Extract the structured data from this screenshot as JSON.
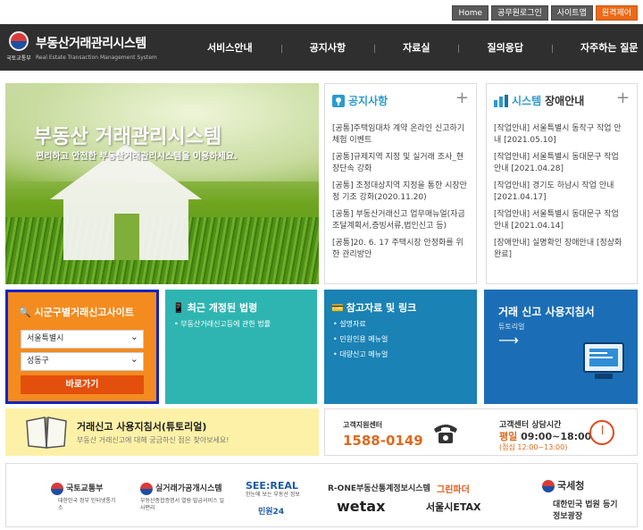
{
  "util": {
    "home": "Home",
    "login": "공무원로그인",
    "sitemap": "사이트맵",
    "remote": "원격제어"
  },
  "header": {
    "ministry": "국토교통부",
    "title": "부동산거래관리시스템",
    "subtitle": "Real Estate Transaction Management System",
    "nav": [
      "서비스안내",
      "공지사항",
      "자료실",
      "질의응답",
      "자주하는 질문"
    ]
  },
  "hero": {
    "title": "부동산 거래관리시스템",
    "subtitle": "편리하고 안전한 부동산거래관리시스템을 이용하세요."
  },
  "notice": {
    "title": "공지사항",
    "more": "+",
    "items": [
      "[공통]주택임대차 계약 온라인 신고하기 체험 이벤트",
      "[공통]규제지역 지정 및 실거래 조사_현장단속 강화",
      "[공통] 조정대상지역 지정을 통한 시장안정 기조 강화(2020.11.20)",
      "[공통] 부동산거래신고 업무매뉴얼(자금조달계획서,증빙서류,법인신고 등)",
      "[공통]20. 6. 17 주택시장 안정화를 위한 관리방안"
    ]
  },
  "system": {
    "title_a": "시스템",
    "title_b": "장애안내",
    "more": "+",
    "items": [
      "[작업안내] 서울특별시 동작구 작업 안내 [2021.05.10]",
      "[작업안내] 서울특별시 동대문구 작업 안내 [2021.04.28]",
      "[작업안내] 경기도 하남시 작업 안내 [2021.04.17]",
      "[작업안내] 서울특별시 동대문구 작업 안내 [2021.04.14]",
      "[장애안내] 실명확인 장애안내 [정상화 완료]"
    ]
  },
  "region": {
    "title": "시군구별거래신고사이트",
    "sido": "서울특별시",
    "sigungu": "성동구",
    "go": "바로가기"
  },
  "laws": {
    "title": "최근 개정된 법령",
    "items": [
      "부동산거래신고등에 관한 법률"
    ]
  },
  "refs": {
    "title": "참고자료 및 링크",
    "items": [
      "설명자료",
      "민원인용 메뉴얼",
      "대량신고 메뉴얼"
    ]
  },
  "guide": {
    "title": "거래 신고 사용지침서",
    "sub": "튜토리얼",
    "arrow": "⟶"
  },
  "tutorial": {
    "title": "거래신고 사용지침서(튜토리얼)",
    "sub": "부동산 거래신고에 대해 궁금하신 점은 찾아보세요!"
  },
  "callcenter": {
    "label": "고객지원센터",
    "number": "1588-0149",
    "hours_label": "고객센터 상담시간",
    "weekday": "평일",
    "hours": "09:00~18:00",
    "lunch": "(점심 12:00~13:00)"
  },
  "partners": {
    "molit": "국토교통부",
    "molit_sub": "대한민국 정부 인터넷통기소",
    "rtms": "실거래가공개시스템",
    "rtms_sub": "부동산종합증명서 열람·발급서비스 일사편리",
    "seereal": "SEE:REAL",
    "seereal_sub": "한눈에 보는 부동산 정보",
    "minwon": "민원24",
    "rone": "R-ONE부동산통계정보시스템",
    "wetax": "wetax",
    "etax": "서울시ETAX",
    "greenfather": "그린파더",
    "nts": "국세청",
    "court": "대한민국 법원 등기정보광장"
  }
}
